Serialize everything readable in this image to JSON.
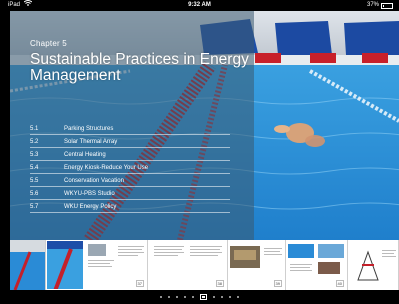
{
  "status": {
    "carrier": "iPad",
    "time": "9:32 AM",
    "battery": "37%"
  },
  "chapter": {
    "label": "Chapter 5",
    "title": "Sustainable Practices in Energy Management"
  },
  "toc": [
    {
      "num": "5.1",
      "title": "Parking Structures"
    },
    {
      "num": "5.2",
      "title": "Solar Thermal Array"
    },
    {
      "num": "5.3",
      "title": "Central Heating"
    },
    {
      "num": "5.4",
      "title": "Energy Kiosk-Reduce Your Use"
    },
    {
      "num": "5.5",
      "title": "Conservation Vacation"
    },
    {
      "num": "5.6",
      "title": "WKYU-PBS Studio"
    },
    {
      "num": "5.7",
      "title": "WKU Energy Policy"
    }
  ],
  "thumbnails": [
    "37",
    "38",
    "39",
    "40"
  ],
  "colors": {
    "pool_blue": "#2a8bd6",
    "lane_red": "#c4202a",
    "overlay": "#4a6f86"
  }
}
